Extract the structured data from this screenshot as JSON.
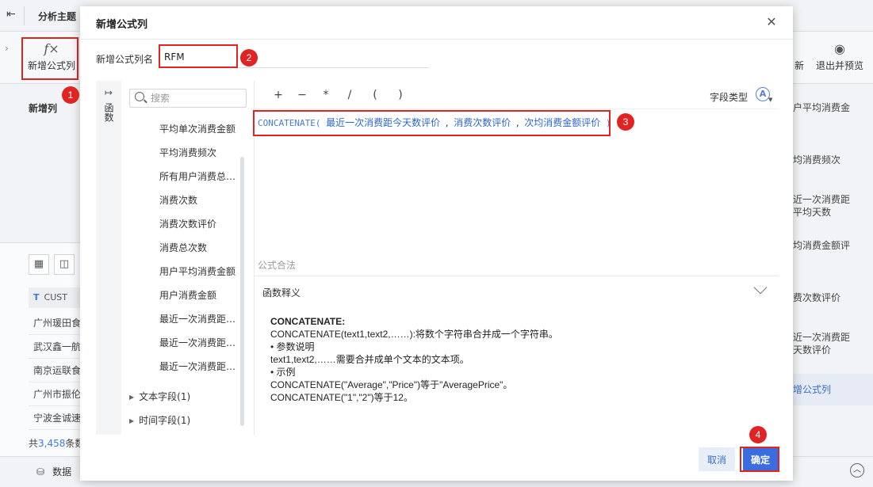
{
  "app": {
    "title": "分析主题",
    "toolbar": {
      "formula_label": "新增公式列",
      "update_label": "新",
      "exit_label": "退出并预览"
    },
    "left": {
      "section_label": "新增列",
      "column_header": "CUST",
      "rows": [
        "广州瑗田食",
        "武汉鑫一航",
        "南京运联食",
        "广州市振伦",
        "宁波金诚速"
      ],
      "count_prefix": "共",
      "count_value": "3,458",
      "count_suffix": "条数"
    },
    "right_items": [
      "户平均消费金",
      "均消费频次",
      "近一次消费距",
      "平均天数",
      "均消费金额评",
      "费次数评价",
      "近一次消费距",
      "天数评价",
      "增公式列"
    ],
    "bottom": {
      "data_label": "数据"
    }
  },
  "modal": {
    "title": "新增公式列",
    "name_label": "新增公式列名",
    "name_value": "RFM",
    "sidebar_tab": "函数",
    "search_placeholder": "搜索",
    "fields": [
      "平均单次消费金额",
      "平均消费频次",
      "所有用户消费总…",
      "消费次数",
      "消费次数评价",
      "消费总次数",
      "用户平均消费金额",
      "用户消费金额",
      "最近一次消费距…",
      "最近一次消费距…",
      "最近一次消费距…"
    ],
    "groups": [
      "文本字段(1)",
      "时间字段(1)"
    ],
    "operators": [
      "+",
      "−",
      "*",
      "/",
      "(",
      ")"
    ],
    "field_type_label": "字段类型",
    "formula": {
      "func": "CONCATENATE(",
      "arg1": "最近一次消费距今天数评价",
      "sep1": ",",
      "arg2": "消费次数评价",
      "sep2": ",",
      "arg3": "次均消费金额评价",
      "close": ")"
    },
    "validity": "公式合法",
    "func_def_label": "函数释义",
    "func_def": {
      "name": "CONCATENATE:",
      "lines": [
        "CONCATENATE(text1,text2,……):将数个字符串合并成一个字符串。",
        "• 参数说明",
        "text1,text2,……需要合并成单个文本的文本项。",
        "• 示例",
        "CONCATENATE(\"Average\",\"Price\")等于\"AveragePrice\"。",
        "CONCATENATE(\"1\",\"2\")等于12。"
      ]
    },
    "cancel_label": "取消",
    "ok_label": "确定"
  },
  "badges": [
    "1",
    "2",
    "3",
    "4"
  ],
  "colors": {
    "accent": "#3a6ee0",
    "highlight": "#e02424"
  }
}
